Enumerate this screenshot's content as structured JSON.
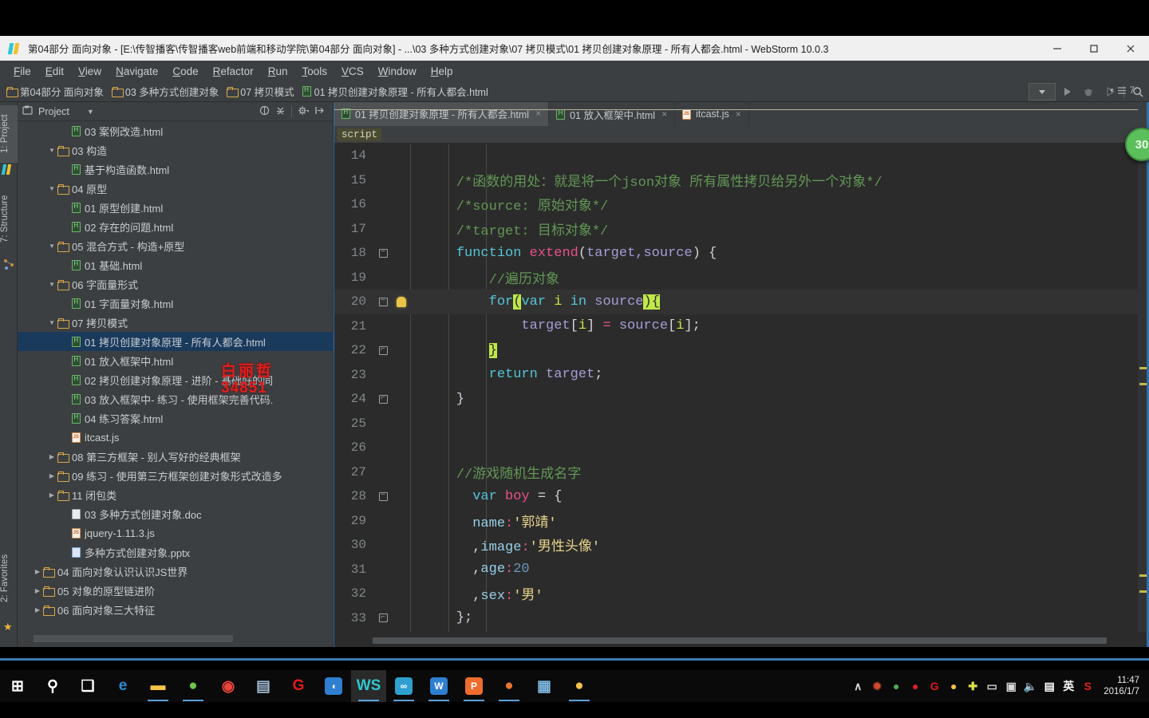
{
  "window": {
    "title": "第04部分 面向对象 - [E:\\传智播客\\传智播客web前端和移动学院\\第04部分 面向对象] - ...\\03 多种方式创建对象\\07 拷贝模式\\01 拷贝创建对象原理 - 所有人都会.html - WebStorm 10.0.3",
    "minimize_label": "─",
    "maximize_label": "□",
    "close_label": "✕"
  },
  "menu": [
    {
      "label": "File"
    },
    {
      "label": "Edit"
    },
    {
      "label": "View"
    },
    {
      "label": "Navigate"
    },
    {
      "label": "Code"
    },
    {
      "label": "Refactor"
    },
    {
      "label": "Run"
    },
    {
      "label": "Tools"
    },
    {
      "label": "VCS"
    },
    {
      "label": "Window"
    },
    {
      "label": "Help"
    }
  ],
  "breadcrumb": [
    {
      "label": "第04部分 面向对象",
      "icon": "folder-icon"
    },
    {
      "label": "03 多种方式创建对象",
      "icon": "folder-icon"
    },
    {
      "label": "07 拷贝模式",
      "icon": "folder-icon"
    },
    {
      "label": "01 拷贝创建对象原理 - 所有人都会.html",
      "icon": "html-file-icon"
    }
  ],
  "toolstrip": {
    "project_tab": "1: Project",
    "structure_tab": "7: Structure",
    "favorites_tab": "2: Favorites"
  },
  "project_panel": {
    "title": "Project",
    "dropdown_caret": "▼",
    "tree": [
      {
        "label": "03 案例改造.html",
        "indent": 3,
        "arrow": "",
        "icon": "html-file-icon",
        "selected": false
      },
      {
        "label": "03 构造",
        "indent": 2,
        "arrow": "▼",
        "icon": "folder-icon",
        "selected": false
      },
      {
        "label": "基于构造函数.html",
        "indent": 3,
        "arrow": "",
        "icon": "html-file-icon",
        "selected": false
      },
      {
        "label": "04 原型",
        "indent": 2,
        "arrow": "▼",
        "icon": "folder-icon",
        "selected": false
      },
      {
        "label": "01 原型创建.html",
        "indent": 3,
        "arrow": "",
        "icon": "html-file-icon",
        "selected": false
      },
      {
        "label": "02 存在的问题.html",
        "indent": 3,
        "arrow": "",
        "icon": "html-file-icon",
        "selected": false
      },
      {
        "label": "05 混合方式 -  构造+原型",
        "indent": 2,
        "arrow": "▼",
        "icon": "folder-icon",
        "selected": false
      },
      {
        "label": "01 基础.html",
        "indent": 3,
        "arrow": "",
        "icon": "html-file-icon",
        "selected": false
      },
      {
        "label": "06 字面量形式",
        "indent": 2,
        "arrow": "▼",
        "icon": "folder-icon",
        "selected": false
      },
      {
        "label": "01 字面量对象.html",
        "indent": 3,
        "arrow": "",
        "icon": "html-file-icon",
        "selected": false
      },
      {
        "label": "07 拷贝模式",
        "indent": 2,
        "arrow": "▼",
        "icon": "folder-icon",
        "selected": false
      },
      {
        "label": "01 拷贝创建对象原理 - 所有人都会.html",
        "indent": 3,
        "arrow": "",
        "icon": "html-file-icon",
        "selected": true
      },
      {
        "label": "01 放入框架中.html",
        "indent": 3,
        "arrow": "",
        "icon": "html-file-icon",
        "selected": false
      },
      {
        "label": "02 拷贝创建对象原理 - 进阶 - 基础好的同",
        "indent": 3,
        "arrow": "",
        "icon": "html-file-icon",
        "selected": false
      },
      {
        "label": "03 放入框架中- 练习 - 使用框架完善代码.",
        "indent": 3,
        "arrow": "",
        "icon": "html-file-icon",
        "selected": false
      },
      {
        "label": "04 练习答案.html",
        "indent": 3,
        "arrow": "",
        "icon": "html-file-icon",
        "selected": false
      },
      {
        "label": "itcast.js",
        "indent": 3,
        "arrow": "",
        "icon": "js-file-icon",
        "selected": false
      },
      {
        "label": "08 第三方框架 - 别人写好的经典框架",
        "indent": 2,
        "arrow": "▶",
        "icon": "folder-icon",
        "selected": false
      },
      {
        "label": "09 练习 - 使用第三方框架创建对象形式改造多",
        "indent": 2,
        "arrow": "▶",
        "icon": "folder-icon",
        "selected": false
      },
      {
        "label": "11 闭包类",
        "indent": 2,
        "arrow": "▶",
        "icon": "folder-icon",
        "selected": false
      },
      {
        "label": "03 多种方式创建对象.doc",
        "indent": 3,
        "arrow": "",
        "icon": "doc-file-icon",
        "selected": false
      },
      {
        "label": "jquery-1.11.3.js",
        "indent": 3,
        "arrow": "",
        "icon": "js-file-icon",
        "selected": false
      },
      {
        "label": "多种方式创建对象.pptx",
        "indent": 3,
        "arrow": "",
        "icon": "ppt-file-icon",
        "selected": false
      },
      {
        "label": "04 面向对象认识认识JS世界",
        "indent": 1,
        "arrow": "▶",
        "icon": "folder-icon",
        "selected": false
      },
      {
        "label": "05 对象的原型链进阶",
        "indent": 1,
        "arrow": "▶",
        "icon": "folder-icon",
        "selected": false
      },
      {
        "label": "06 面向对象三大特征",
        "indent": 1,
        "arrow": "▶",
        "icon": "folder-icon",
        "selected": false
      }
    ]
  },
  "editor": {
    "tabs": [
      {
        "label": "01 拷贝创建对象原理 - 所有人都会.html",
        "icon": "html-file-icon",
        "active": true,
        "close": "×"
      },
      {
        "label": "01 放入框架中.html",
        "icon": "html-file-icon",
        "active": false,
        "close": "×"
      },
      {
        "label": "itcast.js",
        "icon": "js-file-icon",
        "active": false,
        "close": "×"
      }
    ],
    "structure_crumb": "script",
    "inspection_count": "7",
    "recording_badge": "30",
    "first_line": 14,
    "lines": [
      {
        "n": 14,
        "fold": "",
        "bulb": false,
        "highlight": false,
        "tokens": []
      },
      {
        "n": 15,
        "fold": "",
        "bulb": false,
        "highlight": false,
        "tokens": [
          {
            "t": "    /*函数的用处：就是将一个json对象 所有属性拷贝给另外一个对象*/",
            "c": "t-cmt"
          }
        ]
      },
      {
        "n": 16,
        "fold": "",
        "bulb": false,
        "highlight": false,
        "tokens": [
          {
            "t": "    /*source: 原始对象*/",
            "c": "t-cmt"
          }
        ]
      },
      {
        "n": 17,
        "fold": "",
        "bulb": false,
        "highlight": false,
        "tokens": [
          {
            "t": "    /*target: 目标对象*/",
            "c": "t-cmt"
          }
        ]
      },
      {
        "n": 18,
        "fold": "minus",
        "bulb": false,
        "highlight": false,
        "tokens": [
          {
            "t": "    ",
            "c": "t-plain"
          },
          {
            "t": "function",
            "c": "t-cyan"
          },
          {
            "t": " ",
            "c": "t-plain"
          },
          {
            "t": "extend",
            "c": "t-pink"
          },
          {
            "t": "(",
            "c": "t-plain"
          },
          {
            "t": "target,source",
            "c": "t-lav"
          },
          {
            "t": ") {",
            "c": "t-plain"
          }
        ]
      },
      {
        "n": 19,
        "fold": "",
        "bulb": false,
        "highlight": false,
        "tokens": [
          {
            "t": "        //遍历对象",
            "c": "t-cmt"
          }
        ]
      },
      {
        "n": 20,
        "fold": "minus",
        "bulb": true,
        "highlight": true,
        "tokens": [
          {
            "t": "        ",
            "c": "t-plain"
          },
          {
            "t": "for",
            "c": "t-cyan"
          },
          {
            "t": "(",
            "c": "mk"
          },
          {
            "t": "var",
            "c": "t-cyan"
          },
          {
            "t": " ",
            "c": "t-plain"
          },
          {
            "t": "i",
            "c": "t-lime"
          },
          {
            "t": " in ",
            "c": "t-cyan"
          },
          {
            "t": "source",
            "c": "t-lav"
          },
          {
            "t": "){",
            "c": "mk"
          }
        ]
      },
      {
        "n": 21,
        "fold": "",
        "bulb": false,
        "highlight": false,
        "tokens": [
          {
            "t": "            ",
            "c": "t-plain"
          },
          {
            "t": "target",
            "c": "t-lav"
          },
          {
            "t": "[",
            "c": "t-plain"
          },
          {
            "t": "i",
            "c": "t-lime"
          },
          {
            "t": "] ",
            "c": "t-plain"
          },
          {
            "t": "=",
            "c": "t-pink"
          },
          {
            "t": " ",
            "c": "t-plain"
          },
          {
            "t": "source",
            "c": "t-lav"
          },
          {
            "t": "[",
            "c": "t-plain"
          },
          {
            "t": "i",
            "c": "t-lime"
          },
          {
            "t": "];",
            "c": "t-plain"
          }
        ]
      },
      {
        "n": 22,
        "fold": "plus",
        "bulb": false,
        "highlight": false,
        "tokens": [
          {
            "t": "        ",
            "c": "t-plain"
          },
          {
            "t": "}",
            "c": "mk"
          }
        ]
      },
      {
        "n": 23,
        "fold": "",
        "bulb": false,
        "highlight": false,
        "tokens": [
          {
            "t": "        ",
            "c": "t-plain"
          },
          {
            "t": "return",
            "c": "t-cyan"
          },
          {
            "t": " ",
            "c": "t-plain"
          },
          {
            "t": "target",
            "c": "t-lav"
          },
          {
            "t": ";",
            "c": "t-plain"
          }
        ]
      },
      {
        "n": 24,
        "fold": "plus",
        "bulb": false,
        "highlight": false,
        "tokens": [
          {
            "t": "    }",
            "c": "t-plain"
          }
        ]
      },
      {
        "n": 25,
        "fold": "",
        "bulb": false,
        "highlight": false,
        "tokens": []
      },
      {
        "n": 26,
        "fold": "",
        "bulb": false,
        "highlight": false,
        "tokens": []
      },
      {
        "n": 27,
        "fold": "",
        "bulb": false,
        "highlight": false,
        "tokens": [
          {
            "t": "    //游戏随机生成名字",
            "c": "t-cmt"
          }
        ]
      },
      {
        "n": 28,
        "fold": "minus",
        "bulb": false,
        "highlight": false,
        "tokens": [
          {
            "t": "      ",
            "c": "t-plain"
          },
          {
            "t": "var",
            "c": "t-cyan"
          },
          {
            "t": " ",
            "c": "t-plain"
          },
          {
            "t": "boy",
            "c": "t-pink"
          },
          {
            "t": " ",
            "c": "t-plain"
          },
          {
            "t": "=",
            "c": "t-plain"
          },
          {
            "t": " {",
            "c": "t-plain"
          }
        ]
      },
      {
        "n": 29,
        "fold": "",
        "bulb": false,
        "highlight": false,
        "tokens": [
          {
            "t": "      ",
            "c": "t-plain"
          },
          {
            "t": "name",
            "c": "t-prop"
          },
          {
            "t": ":",
            "c": "t-pink"
          },
          {
            "t": "'郭靖'",
            "c": "t-str"
          }
        ]
      },
      {
        "n": 30,
        "fold": "",
        "bulb": false,
        "highlight": false,
        "tokens": [
          {
            "t": "      ",
            "c": "t-plain"
          },
          {
            "t": ",",
            "c": "t-plain"
          },
          {
            "t": "image",
            "c": "t-prop"
          },
          {
            "t": ":",
            "c": "t-pink"
          },
          {
            "t": "'男性头像'",
            "c": "t-str"
          }
        ]
      },
      {
        "n": 31,
        "fold": "",
        "bulb": false,
        "highlight": false,
        "tokens": [
          {
            "t": "      ",
            "c": "t-plain"
          },
          {
            "t": ",",
            "c": "t-plain"
          },
          {
            "t": "age",
            "c": "t-prop"
          },
          {
            "t": ":",
            "c": "t-pink"
          },
          {
            "t": "20",
            "c": "t-num"
          }
        ]
      },
      {
        "n": 32,
        "fold": "",
        "bulb": false,
        "highlight": false,
        "tokens": [
          {
            "t": "      ",
            "c": "t-plain"
          },
          {
            "t": ",",
            "c": "t-plain"
          },
          {
            "t": "sex",
            "c": "t-prop"
          },
          {
            "t": ":",
            "c": "t-pink"
          },
          {
            "t": "'男'",
            "c": "t-str"
          }
        ]
      },
      {
        "n": 33,
        "fold": "plus",
        "bulb": false,
        "highlight": false,
        "tokens": [
          {
            "t": "    };",
            "c": "t-plain"
          }
        ]
      }
    ]
  },
  "watermark": {
    "line1": "白丽哲",
    "line2": "34851"
  },
  "taskbar": {
    "apps": [
      {
        "name": "start-button",
        "glyph": "⊞",
        "color": "#ffffff",
        "bg": "transparent",
        "active": false,
        "running": false
      },
      {
        "name": "search-icon",
        "glyph": "⚲",
        "color": "#ffffff",
        "bg": "transparent",
        "active": false,
        "running": false
      },
      {
        "name": "task-view-icon",
        "glyph": "❑",
        "color": "#ffffff",
        "bg": "transparent",
        "active": false,
        "running": false
      },
      {
        "name": "edge-icon",
        "glyph": "e",
        "color": "#2b8fd8",
        "bg": "transparent",
        "active": false,
        "running": false
      },
      {
        "name": "file-explorer-icon",
        "glyph": "▬",
        "color": "#f5c349",
        "bg": "transparent",
        "active": false,
        "running": true
      },
      {
        "name": "browser-360-icon",
        "glyph": "●",
        "color": "#6fc44a",
        "bg": "transparent",
        "active": false,
        "running": true
      },
      {
        "name": "chrome-icon",
        "glyph": "◉",
        "color": "#e8453c",
        "bg": "transparent",
        "active": false,
        "running": false
      },
      {
        "name": "search-tool-icon",
        "glyph": "▤",
        "color": "#9fb8cf",
        "bg": "transparent",
        "active": false,
        "running": false
      },
      {
        "name": "g-app-icon",
        "glyph": "G",
        "color": "#e01b1b",
        "bg": "transparent",
        "active": false,
        "running": false
      },
      {
        "name": "blue-app-icon",
        "glyph": "◖",
        "color": "#ffffff",
        "bg": "#2f7fd0",
        "active": false,
        "running": false
      },
      {
        "name": "webstorm-icon",
        "glyph": "WS",
        "color": "#2fc8d1",
        "bg": "transparent",
        "active": true,
        "running": true
      },
      {
        "name": "cloud-app-icon",
        "glyph": "∞",
        "color": "#ffffff",
        "bg": "#2f9fd0",
        "active": false,
        "running": true
      },
      {
        "name": "wps-word-icon",
        "glyph": "W",
        "color": "#ffffff",
        "bg": "#2f7fd0",
        "active": false,
        "running": true
      },
      {
        "name": "wps-ppt-icon",
        "glyph": "P",
        "color": "#ffffff",
        "bg": "#ef6c2f",
        "active": false,
        "running": true
      },
      {
        "name": "firefox-icon",
        "glyph": "●",
        "color": "#e8752f",
        "bg": "transparent",
        "active": false,
        "running": true
      },
      {
        "name": "media-app-icon",
        "glyph": "▦",
        "color": "#7fb8e0",
        "bg": "transparent",
        "active": false,
        "running": false
      },
      {
        "name": "balloons-icon",
        "glyph": "●",
        "color": "#f5c349",
        "bg": "transparent",
        "active": false,
        "running": true
      }
    ],
    "tray": [
      {
        "name": "show-hidden-icons",
        "glyph": "∧",
        "color": "#d8d8d8"
      },
      {
        "name": "android-tool-icon",
        "glyph": "✹",
        "color": "#d04a2a"
      },
      {
        "name": "green-status-icon",
        "glyph": "●",
        "color": "#4caf50"
      },
      {
        "name": "red-record-icon",
        "glyph": "●",
        "color": "#e02020"
      },
      {
        "name": "g-tray-icon",
        "glyph": "G",
        "color": "#e01b1b"
      },
      {
        "name": "balloons-tray-icon",
        "glyph": "●",
        "color": "#f5c349"
      },
      {
        "name": "plus-tray-icon",
        "glyph": "✚",
        "color": "#d8e04a"
      },
      {
        "name": "battery-icon",
        "glyph": "▭",
        "color": "#d8d8d8"
      },
      {
        "name": "network-warning-icon",
        "glyph": "▣",
        "color": "#d8d8d8"
      },
      {
        "name": "volume-muted-icon",
        "glyph": "🔈",
        "color": "#d8d8d8"
      },
      {
        "name": "notification-icon",
        "glyph": "▤",
        "color": "#ffffff"
      },
      {
        "name": "ime-language-icon",
        "glyph": "英",
        "color": "#ffffff"
      },
      {
        "name": "sogou-icon",
        "glyph": "S",
        "color": "#e02020"
      }
    ],
    "clock_time": "11:47",
    "clock_date": "2016/1/7"
  }
}
